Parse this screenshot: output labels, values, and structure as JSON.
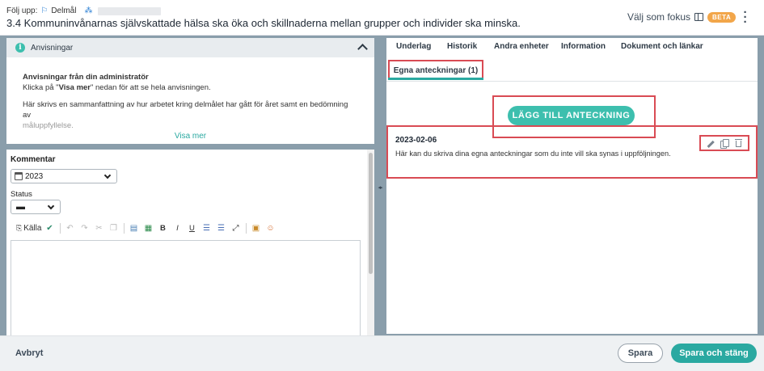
{
  "header": {
    "breadcrumb_prefix": "Följ upp:",
    "breadcrumb_item": "Delmål",
    "title": "3.4 Kommuninvånarnas självskattade hälsa ska öka och skillnaderna mellan grupper och individer ska minska.",
    "focus_label": "Välj som fokus",
    "beta_badge": "BETA"
  },
  "guide": {
    "heading": "Anvisningar",
    "admin_title": "Anvisningar från din administratör",
    "click_prefix": "Klicka på \"",
    "click_link": "Visa mer",
    "click_suffix": "\" nedan för att se hela anvisningen.",
    "paragraph": "Här skrivs en sammanfattning av hur arbetet kring delmålet har gått för året samt en bedömning av",
    "paragraph_fade": "måluppfyllelse.",
    "show_more": "Visa mer"
  },
  "comment": {
    "label": "Kommentar",
    "year_value": "2023",
    "status_label": "Status",
    "status_value": "▬",
    "toolbar_source": "Källa",
    "toolbar_bold": "B",
    "toolbar_italic": "I",
    "toolbar_underline": "U"
  },
  "tabs": {
    "items": [
      "Underlag",
      "Historik",
      "Andra enheter",
      "Information",
      "Dokument och länkar"
    ],
    "active": "Egna anteckningar (1)"
  },
  "notes": {
    "add_button": "LÄGG TILL ANTECKNING",
    "items": [
      {
        "date": "2023-02-06",
        "text": "Här kan du skriva dina egna anteckningar som du inte vill ska synas i uppföljningen."
      }
    ]
  },
  "footer": {
    "cancel": "Avbryt",
    "save": "Spara",
    "save_close": "Spara och stäng"
  },
  "colors": {
    "accent": "#2aa9a1",
    "accent_light": "#3dbfae",
    "highlight": "#d94b54",
    "beta": "#f2a64a",
    "backdrop": "#8a9eab"
  }
}
